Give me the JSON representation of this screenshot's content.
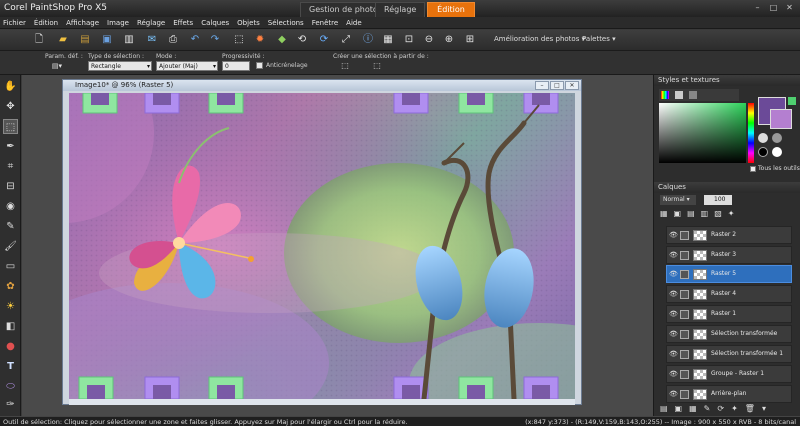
{
  "app": {
    "title": "Corel PaintShop Pro X5"
  },
  "workspace_tabs": [
    {
      "label": "Gestion de photos"
    },
    {
      "label": "Réglage"
    },
    {
      "label": "Édition"
    }
  ],
  "menu": [
    "Fichier",
    "Édition",
    "Affichage",
    "Image",
    "Réglage",
    "Effets",
    "Calques",
    "Objets",
    "Sélections",
    "Fenêtre",
    "Aide"
  ],
  "toolbar": {
    "photo_enhance": "Amélioration des photos",
    "palettes": "Palettes"
  },
  "tool_options": {
    "presets_label": "Param. déf. :",
    "selection_type_label": "Type de sélection :",
    "selection_type_value": "Rectangle",
    "mode_label": "Mode :",
    "mode_value": "Ajouter (Maj)",
    "feather_label": "Progressivité :",
    "feather_value": "0",
    "antialias_label": "Anticrénelage",
    "create_from_label": "Créer une sélection à partir de :"
  },
  "image_window": {
    "title": "Image10* @ 96% (Raster 5)"
  },
  "styles_panel": {
    "title": "Styles et textures",
    "all_tools_label": "Tous les outils"
  },
  "layers_panel": {
    "title": "Calques",
    "blend_mode": "Normal",
    "opacity": "100",
    "layers": [
      {
        "name": "Raster 2"
      },
      {
        "name": "Raster 3"
      },
      {
        "name": "Raster 5"
      },
      {
        "name": "Raster 4"
      },
      {
        "name": "Raster 1"
      },
      {
        "name": "Sélection transformée"
      },
      {
        "name": "Sélection transformée 1"
      },
      {
        "name": "Groupe - Raster 1"
      },
      {
        "name": "Arrière-plan"
      }
    ]
  },
  "status": {
    "left": "Outil de sélection: Cliquez pour sélectionner une zone et faites glisser. Appuyez sur Maj pour l'élargir ou Ctrl pour la réduire.",
    "right": "(x:847 y:373) - (R:149,V:159,B:143,O:255) -- Image : 900 x 550 x RVB - 8 bits/canal"
  },
  "colors": {
    "accent": "#e8720c",
    "selection": "#2e6fbd",
    "foreground": "#6b4a98",
    "background": "#b47fd0"
  }
}
